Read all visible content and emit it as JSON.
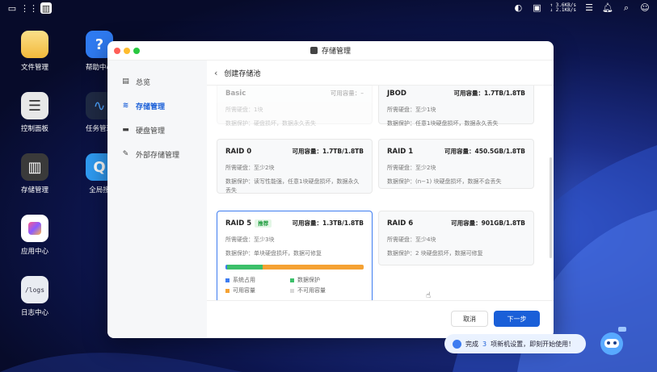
{
  "topbar": {
    "upload": "↑ 3.6KB/s",
    "download": "↓ 2.1KB/s"
  },
  "desktop": [
    {
      "label": "文件管理",
      "icon": "folder-icon"
    },
    {
      "label": "帮助中心",
      "icon": "help-icon"
    },
    {
      "label": "控制面板",
      "icon": "control-panel-icon"
    },
    {
      "label": "任务管理",
      "icon": "task-manager-icon"
    },
    {
      "label": "存储管理",
      "icon": "storage-icon"
    },
    {
      "label": "全局搜",
      "icon": "search-icon"
    },
    {
      "label": "应用中心",
      "icon": "app-center-icon"
    },
    {
      "label": "日志中心",
      "icon": "log-icon"
    }
  ],
  "window": {
    "title": "存储管理"
  },
  "sidebar": {
    "items": [
      {
        "label": "总览",
        "icon": "overview-icon"
      },
      {
        "label": "存储管理",
        "icon": "storage-stack-icon"
      },
      {
        "label": "硬盘管理",
        "icon": "disk-icon"
      },
      {
        "label": "外部存储管理",
        "icon": "external-storage-icon"
      }
    ]
  },
  "main": {
    "title": "创建存储池"
  },
  "cards": [
    {
      "name": "Basic",
      "capacity": "可用容量：–",
      "disks": "所需硬盘：1块",
      "protect": "数据保护：硬盘损坏，数据永久丢失"
    },
    {
      "name": "JBOD",
      "capacity": "可用容量：1.7TB/1.8TB",
      "disks": "所需硬盘：至少1块",
      "protect": "数据保护：任意1块硬盘损坏，数据永久丢失"
    },
    {
      "name": "RAID 0",
      "capacity": "可用容量：1.7TB/1.8TB",
      "disks": "所需硬盘：至少2块",
      "protect": "数据保护：读写性能强，任意1块硬盘损坏，数据永久丢失"
    },
    {
      "name": "RAID 1",
      "capacity": "可用容量：450.5GB/1.8TB",
      "disks": "所需硬盘：至少2块",
      "protect": "数据保护：(n−1) 块硬盘损坏，数据不会丢失"
    },
    {
      "name": "RAID 5",
      "badge": "推荐",
      "capacity": "可用容量：1.3TB/1.8TB",
      "disks": "所需硬盘：至少3块",
      "protect": "数据保护：单块硬盘损坏，数据可修复"
    },
    {
      "name": "RAID 6",
      "capacity": "可用容量：901GB/1.8TB",
      "disks": "所需硬盘：至少4块",
      "protect": "数据保护：2 块硬盘损坏，数据可修复"
    }
  ],
  "legend": {
    "system": "系统占用",
    "protect": "数据保护",
    "available": "可用容量",
    "unavailable": "不可用容量"
  },
  "bar_shares": {
    "system": 0.01,
    "protect": 0.26,
    "available": 0.73
  },
  "colors": {
    "accent": "#1a5fd8",
    "system": "#3d7cf0",
    "protect": "#3cc06a",
    "available": "#f5a233",
    "unavailable": "#d9d9d9"
  },
  "footer": {
    "cancel": "取消",
    "next": "下一步"
  },
  "toast": {
    "prefix": "完成",
    "count": "3",
    "suffix": "项新机设置，即刻开始使用！"
  }
}
